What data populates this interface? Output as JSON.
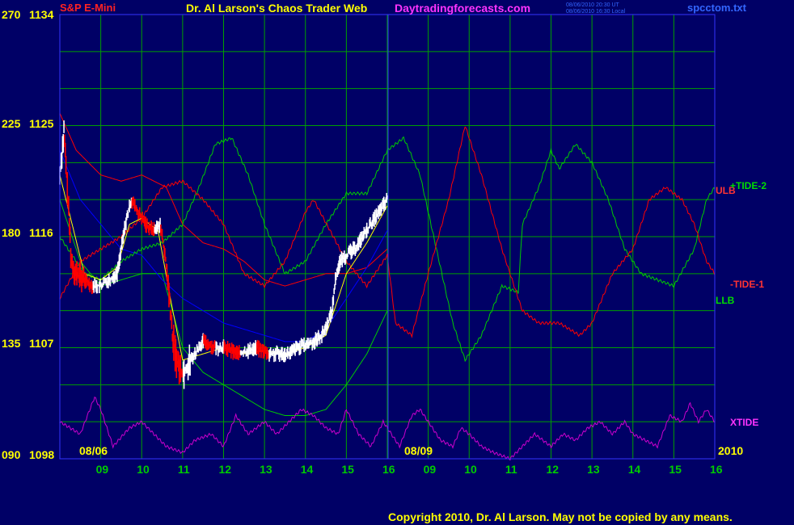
{
  "header": {
    "instrument": "S&P E-Mini",
    "title": "Dr. Al Larson's Chaos Trader Web",
    "site": "Daytradingforecasts.com",
    "ut_time": "08/06/2010 20:30 UT",
    "local_time": "08/06/2010 16:30 Local",
    "filename": "spcctom.txt"
  },
  "footer": {
    "copyright": "Copyright 2010, Dr. Al Larson. May not be copied by any means."
  },
  "colors": {
    "background": "#000066",
    "grid": "#00a000",
    "price_up": "#ffffff",
    "price_down": "#ff0000",
    "avg": "#ffff00",
    "ulb": "#ff0000",
    "llb": "#00cc00",
    "blue_avg": "#0000ff",
    "tide_plus": "#00cc00",
    "tide_minus": "#ff0000",
    "xtide": "#cc00cc",
    "now_line": "#3333ff"
  },
  "chart_data": {
    "type": "line",
    "title": "S&P E-Mini",
    "y_left_ticks": [
      "270",
      "225",
      "180",
      "135",
      "090"
    ],
    "y_right_ticks": [
      "1134",
      "1125",
      "1116",
      "1107",
      "1098"
    ],
    "ylim_price": [
      1098,
      1134
    ],
    "ylim_tide": [
      90,
      270
    ],
    "date_labels": [
      "08/06",
      "08/09",
      "2010"
    ],
    "x_ticks": [
      "09",
      "10",
      "11",
      "12",
      "13",
      "14",
      "15",
      "16",
      "09",
      "10",
      "11",
      "12",
      "13",
      "14",
      "15",
      "16"
    ],
    "x_range": [
      8.0,
      24.0
    ],
    "series_labels": [
      "ULB",
      "+TIDE-2",
      "-TIDE-1",
      "LLB",
      "XTIDE"
    ],
    "price_anchors": [
      [
        8.0,
        1121
      ],
      [
        8.1,
        1124.5
      ],
      [
        8.2,
        1119
      ],
      [
        8.28,
        1114
      ],
      [
        8.4,
        1113
      ],
      [
        8.6,
        1112.5
      ],
      [
        8.8,
        1112
      ],
      [
        9.0,
        1112
      ],
      [
        9.2,
        1112.5
      ],
      [
        9.4,
        1113
      ],
      [
        9.6,
        1117
      ],
      [
        9.75,
        1119
      ],
      [
        9.9,
        1118
      ],
      [
        10.1,
        1117
      ],
      [
        10.3,
        1116.5
      ],
      [
        10.45,
        1117
      ],
      [
        10.55,
        1115
      ],
      [
        10.65,
        1112
      ],
      [
        10.75,
        1108
      ],
      [
        10.85,
        1106
      ],
      [
        11.0,
        1105
      ],
      [
        11.2,
        1106
      ],
      [
        11.5,
        1107.5
      ],
      [
        11.8,
        1107
      ],
      [
        12.0,
        1107
      ],
      [
        12.4,
        1106.5
      ],
      [
        12.8,
        1107
      ],
      [
        13.1,
        1106.5
      ],
      [
        13.4,
        1106.5
      ],
      [
        13.6,
        1106.5
      ],
      [
        13.8,
        1107
      ],
      [
        14.0,
        1107.2
      ],
      [
        14.2,
        1107.5
      ],
      [
        14.4,
        1108
      ],
      [
        14.55,
        1109
      ],
      [
        14.65,
        1110
      ],
      [
        14.75,
        1113
      ],
      [
        14.85,
        1114
      ],
      [
        15.0,
        1114.5
      ],
      [
        15.2,
        1115
      ],
      [
        15.4,
        1116
      ],
      [
        15.6,
        1117
      ],
      [
        15.8,
        1118
      ],
      [
        16.0,
        1119
      ]
    ],
    "series": [
      {
        "name": "ULB",
        "color": "#ff0000",
        "anchors": [
          [
            8,
            1126
          ],
          [
            8.4,
            1123
          ],
          [
            9,
            1121
          ],
          [
            9.5,
            1120.5
          ],
          [
            10,
            1121
          ],
          [
            10.6,
            1120
          ],
          [
            11,
            1117
          ],
          [
            11.5,
            1115.5
          ],
          [
            12,
            1115
          ],
          [
            12.5,
            1114
          ],
          [
            13,
            1112.5
          ],
          [
            13.5,
            1112
          ],
          [
            14,
            1112.5
          ],
          [
            14.5,
            1113
          ],
          [
            15,
            1113
          ],
          [
            15.5,
            1113.5
          ],
          [
            16,
            1115
          ]
        ]
      },
      {
        "name": "LLB",
        "color": "#00cc00",
        "anchors": [
          [
            8,
            1119
          ],
          [
            8.5,
            1114
          ],
          [
            9,
            1112
          ],
          [
            9.5,
            1112.5
          ],
          [
            10,
            1113
          ],
          [
            10.5,
            1113
          ],
          [
            11,
            1107
          ],
          [
            11.5,
            1105
          ],
          [
            12,
            1104
          ],
          [
            12.5,
            1103
          ],
          [
            13,
            1102
          ],
          [
            13.5,
            1101.5
          ],
          [
            14,
            1101.5
          ],
          [
            14.5,
            1102
          ],
          [
            15,
            1104
          ],
          [
            15.5,
            1106.5
          ],
          [
            16,
            1110
          ]
        ]
      },
      {
        "name": "blue",
        "color": "#0000ff",
        "anchors": [
          [
            8,
            1123
          ],
          [
            8.5,
            1119
          ],
          [
            9,
            1117
          ],
          [
            9.5,
            1115
          ],
          [
            10,
            1114.5
          ],
          [
            10.5,
            1112.5
          ],
          [
            11,
            1111
          ],
          [
            11.5,
            1110
          ],
          [
            12,
            1109
          ],
          [
            12.5,
            1108.5
          ],
          [
            13,
            1108
          ],
          [
            13.5,
            1107.5
          ],
          [
            14,
            1107.5
          ],
          [
            14.5,
            1108.5
          ],
          [
            15,
            1111
          ],
          [
            15.5,
            1113.5
          ],
          [
            16,
            1116.5
          ]
        ]
      },
      {
        "name": "+TIDE-2",
        "color": "#00cc00",
        "anchors": [
          [
            8,
            1116
          ],
          [
            8.6,
            1113
          ],
          [
            9,
            1112.5
          ],
          [
            9.5,
            1114
          ],
          [
            10,
            1115
          ],
          [
            10.5,
            1115.5
          ],
          [
            11,
            1117
          ],
          [
            11.4,
            1120
          ],
          [
            11.8,
            1123.5
          ],
          [
            12.2,
            1124
          ],
          [
            12.6,
            1121
          ],
          [
            13,
            1117
          ],
          [
            13.5,
            1113
          ],
          [
            14,
            1114
          ],
          [
            14.5,
            1117
          ],
          [
            15,
            1119.5
          ],
          [
            15.5,
            1119.5
          ],
          [
            16,
            1123
          ],
          [
            16.4,
            1124
          ],
          [
            16.8,
            1121
          ],
          [
            17.2,
            1115
          ],
          [
            17.6,
            1109
          ],
          [
            17.9,
            1106
          ],
          [
            18.3,
            1108
          ],
          [
            18.8,
            1112
          ],
          [
            19.2,
            1111.5
          ],
          [
            19.3,
            1117
          ],
          [
            19.7,
            1120
          ],
          [
            20,
            1123
          ],
          [
            20.2,
            1121.5
          ],
          [
            20.6,
            1123.5
          ],
          [
            21,
            1122
          ],
          [
            21.4,
            1119
          ],
          [
            21.8,
            1115
          ],
          [
            22.2,
            1113
          ],
          [
            22.6,
            1112.5
          ],
          [
            23,
            1112
          ],
          [
            23.5,
            1115
          ],
          [
            23.8,
            1119
          ],
          [
            24,
            1120
          ]
        ]
      },
      {
        "name": "-TIDE-1",
        "color": "#ff0000",
        "anchors": [
          [
            8,
            1111
          ],
          [
            8.5,
            1114
          ],
          [
            9,
            1115
          ],
          [
            9.5,
            1116
          ],
          [
            10,
            1117.5
          ],
          [
            10.5,
            1120
          ],
          [
            11,
            1120.5
          ],
          [
            11.5,
            1119
          ],
          [
            12,
            1117
          ],
          [
            12.5,
            1113
          ],
          [
            13,
            1112
          ],
          [
            13.5,
            1114
          ],
          [
            14,
            1118
          ],
          [
            14.2,
            1119
          ],
          [
            14.6,
            1116.5
          ],
          [
            15,
            1114
          ],
          [
            15.5,
            1112
          ],
          [
            16,
            1114.5
          ],
          [
            16.2,
            1109
          ],
          [
            16.6,
            1108
          ],
          [
            17,
            1113
          ],
          [
            17.5,
            1119
          ],
          [
            17.9,
            1125
          ],
          [
            18.3,
            1121
          ],
          [
            18.8,
            1115
          ],
          [
            19.3,
            1110
          ],
          [
            19.7,
            1109
          ],
          [
            20.2,
            1109
          ],
          [
            20.7,
            1108
          ],
          [
            21,
            1109
          ],
          [
            21.5,
            1113
          ],
          [
            22,
            1115
          ],
          [
            22.4,
            1119
          ],
          [
            22.8,
            1120
          ],
          [
            23.2,
            1119
          ],
          [
            23.5,
            1117
          ],
          [
            23.8,
            1114
          ],
          [
            24,
            1113
          ]
        ]
      },
      {
        "name": "XTIDE",
        "color": "#cc00cc",
        "anchors": [
          [
            8,
            1101
          ],
          [
            8.5,
            1100
          ],
          [
            8.85,
            1103
          ],
          [
            9,
            1102
          ],
          [
            9.3,
            1099
          ],
          [
            9.7,
            1100.5
          ],
          [
            10,
            1101
          ],
          [
            10.3,
            1100
          ],
          [
            10.6,
            1099
          ],
          [
            11,
            1098.5
          ],
          [
            11.3,
            1099.5
          ],
          [
            11.7,
            1100
          ],
          [
            12,
            1099
          ],
          [
            12.3,
            1101.5
          ],
          [
            12.6,
            1100
          ],
          [
            13,
            1101
          ],
          [
            13.3,
            1100
          ],
          [
            13.6,
            1101
          ],
          [
            13.9,
            1102
          ],
          [
            14.2,
            1101.5
          ],
          [
            14.5,
            1100.5
          ],
          [
            14.8,
            1100
          ],
          [
            15,
            1102
          ],
          [
            15.3,
            1100
          ],
          [
            15.6,
            1099
          ],
          [
            15.9,
            1101
          ],
          [
            16,
            1100.5
          ],
          [
            16.3,
            1099
          ],
          [
            16.6,
            1101.5
          ],
          [
            16.8,
            1102
          ],
          [
            17,
            1101
          ],
          [
            17.3,
            1099.5
          ],
          [
            17.6,
            1099
          ],
          [
            17.8,
            1100.5
          ],
          [
            18,
            1100
          ],
          [
            18.3,
            1099
          ],
          [
            18.6,
            1098.5
          ],
          [
            19,
            1098
          ],
          [
            19.3,
            1099
          ],
          [
            19.6,
            1100
          ],
          [
            20,
            1099
          ],
          [
            20.3,
            1100
          ],
          [
            20.6,
            1099.5
          ],
          [
            20.9,
            1100.5
          ],
          [
            21.2,
            1101
          ],
          [
            21.5,
            1100
          ],
          [
            21.8,
            1101
          ],
          [
            22,
            1100
          ],
          [
            22.3,
            1099.5
          ],
          [
            22.6,
            1099
          ],
          [
            22.9,
            1101.5
          ],
          [
            23.2,
            1101
          ],
          [
            23.4,
            1102.5
          ],
          [
            23.6,
            1101
          ],
          [
            23.8,
            1102
          ],
          [
            24,
            1101
          ]
        ]
      },
      {
        "name": "avg",
        "color": "#ffff00",
        "anchors": [
          [
            8,
            1121
          ],
          [
            8.3,
            1117
          ],
          [
            8.6,
            1113
          ],
          [
            9,
            1112.5
          ],
          [
            9.4,
            1113.5
          ],
          [
            9.7,
            1117
          ],
          [
            10,
            1117.5
          ],
          [
            10.4,
            1116.5
          ],
          [
            10.7,
            1111
          ],
          [
            11,
            1106
          ],
          [
            11.5,
            1106.5
          ],
          [
            12,
            1107
          ],
          [
            12.5,
            1106.5
          ],
          [
            13,
            1106.8
          ],
          [
            13.5,
            1106.5
          ],
          [
            14,
            1107
          ],
          [
            14.5,
            1108
          ],
          [
            15,
            1113
          ],
          [
            15.5,
            1115.5
          ],
          [
            16,
            1118.5
          ]
        ]
      }
    ]
  }
}
